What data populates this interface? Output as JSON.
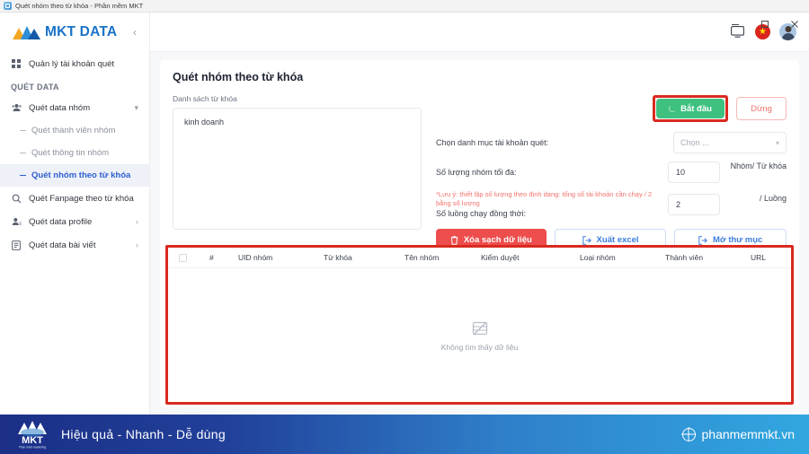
{
  "window": {
    "title": "Quét nhóm theo từ khóa - Phần mềm MKT",
    "app_icon": "app-window-icon",
    "minimize": "minimize-icon",
    "maximize": "maximize-icon",
    "close": "close-icon"
  },
  "sidebar": {
    "logo_text": "MKT DATA",
    "collapse_icon": "chevron-left-icon",
    "top_item": {
      "label": "Quản lý tài khoản quét",
      "icon": "grid-icon"
    },
    "section_label": "QUÉT DATA",
    "groups": [
      {
        "label": "Quét data nhóm",
        "icon": "users-icon",
        "chevron": "chevron-down-icon",
        "expanded": true,
        "children": [
          {
            "label": "Quét thành viên nhóm",
            "active": false
          },
          {
            "label": "Quét thông tin nhóm",
            "active": false
          },
          {
            "label": "Quét nhóm theo từ khóa",
            "active": true
          }
        ]
      }
    ],
    "items": [
      {
        "label": "Quét Fanpage theo từ khóa",
        "icon": "search-icon",
        "chevron": ""
      },
      {
        "label": "Quét data profile",
        "icon": "user-profile-icon",
        "chevron": "chevron-right-icon"
      },
      {
        "label": "Quét data bài viết",
        "icon": "article-icon",
        "chevron": "chevron-right-icon"
      }
    ]
  },
  "appbar": {
    "screen_icon": "monitor-icon",
    "language_flag": "vietnam-flag-icon",
    "flag_star": "★",
    "avatar": "user-avatar"
  },
  "main": {
    "page_title": "Quét nhóm theo từ khóa",
    "keyword_label": "Danh sách từ khóa",
    "keyword_value": "kinh doanh",
    "start_button": "Bắt đầu",
    "stop_button": "Dừng",
    "fields": {
      "category_label": "Chọn danh mục tài khoản quét:",
      "category_value": "Chọn ...",
      "max_groups_label": "Số lượng nhóm tối đa:",
      "max_groups_value": "10",
      "max_groups_unit": "Nhóm/ Từ khóa",
      "note": "*Lưu ý: thiết lập số lượng theo định dạng: tổng số tài khoản cần chạy / 2 bằng số lượng",
      "threads_label": "Số luồng chạy đồng thời:",
      "threads_value": "2",
      "threads_unit": "/ Luồng"
    },
    "actions": [
      {
        "label": "Xóa sạch dữ liệu",
        "icon": "trash-icon",
        "style": "danger"
      },
      {
        "label": "Xuất excel",
        "icon": "export-icon",
        "style": "outline"
      },
      {
        "label": "Mở thư mục",
        "icon": "folder-open-icon",
        "style": "outline"
      }
    ]
  },
  "table": {
    "select_all": "checkbox-icon",
    "columns": [
      "#",
      "UID nhóm",
      "Từ khóa",
      "Tên nhóm",
      "Kiểm duyệt",
      "Loại nhóm",
      "Thành viên",
      "URL"
    ],
    "rows": [],
    "empty_icon": "no-data-icon",
    "empty_text": "Không tìm thấy dữ liệu"
  },
  "banner": {
    "logo": "MKT",
    "logo_sub": "Phần mềm marketing",
    "slogan": "Hiệu quả - Nhanh  - Dễ dùng",
    "website": "phanmemmkt.vn",
    "globe_icon": "globe-icon"
  },
  "colors": {
    "brand_blue": "#1a73c8",
    "accent_green": "#3ec17f",
    "danger_red": "#ee4d4d",
    "highlight_red": "#d92a20",
    "link_blue": "#3b7ddd",
    "note_red": "#f2726d"
  }
}
